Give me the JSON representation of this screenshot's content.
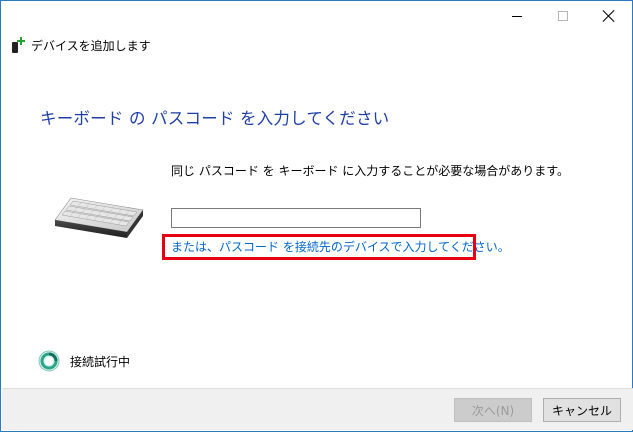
{
  "window": {
    "title": "デバイスを追加します"
  },
  "main": {
    "heading": "キーボード の パスコード を入力してください",
    "instruction": "同じ パスコード を キーボード に入力することが必要な場合があります。",
    "passcode_value": "",
    "alt_link": "または、パスコード を接続先のデバイスで入力してください。"
  },
  "status": {
    "text": "接続試行中"
  },
  "footer": {
    "next_label": "次へ(N)",
    "cancel_label": "キャンセル"
  },
  "colors": {
    "heading": "#1f3fa8",
    "link": "#0066cc",
    "highlight": "#e60012",
    "window_border": "#2b79c2"
  },
  "icons": {
    "window_icon": "add-device-icon",
    "illustration": "keyboard-icon",
    "status": "spinner-icon"
  }
}
